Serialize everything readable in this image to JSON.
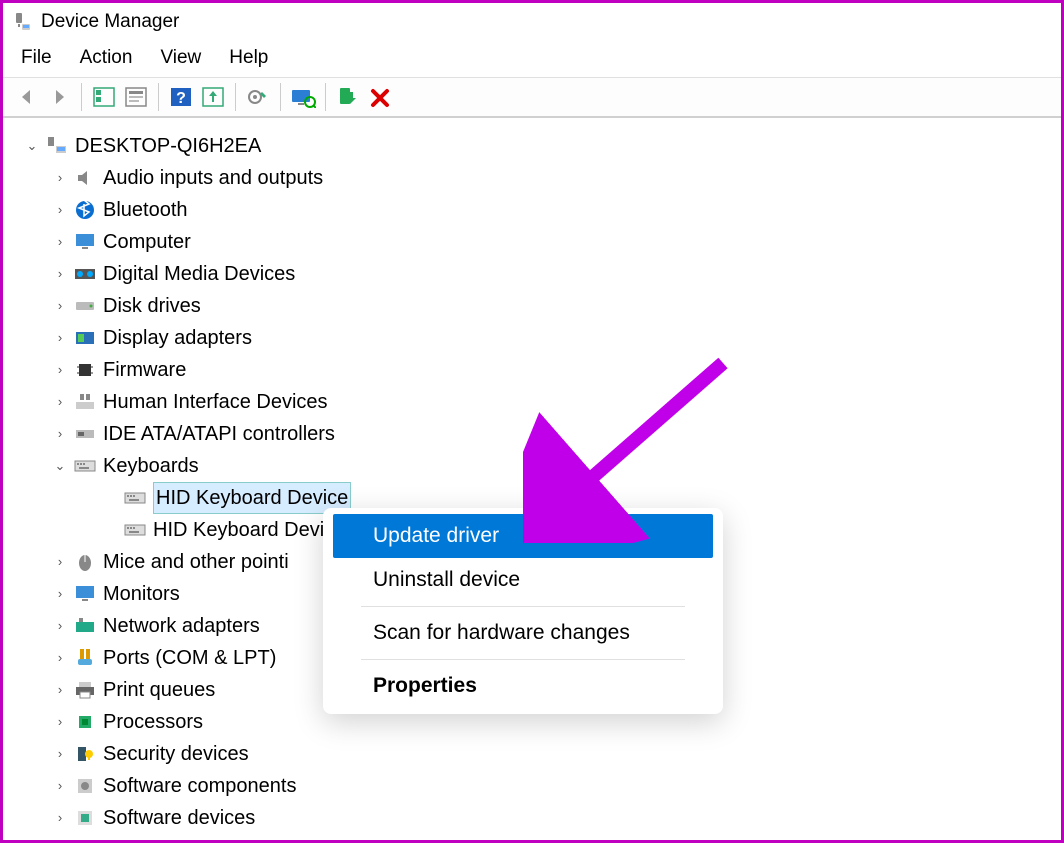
{
  "window": {
    "title": "Device Manager"
  },
  "menu": {
    "items": [
      "File",
      "Action",
      "View",
      "Help"
    ]
  },
  "tree": {
    "root": {
      "label": "DESKTOP-QI6H2EA",
      "expanded": true
    },
    "children": [
      {
        "label": "Audio inputs and outputs",
        "expanded": false
      },
      {
        "label": "Bluetooth",
        "expanded": false
      },
      {
        "label": "Computer",
        "expanded": false
      },
      {
        "label": "Digital Media Devices",
        "expanded": false
      },
      {
        "label": "Disk drives",
        "expanded": false
      },
      {
        "label": "Display adapters",
        "expanded": false
      },
      {
        "label": "Firmware",
        "expanded": false
      },
      {
        "label": "Human Interface Devices",
        "expanded": false
      },
      {
        "label": "IDE ATA/ATAPI controllers",
        "expanded": false
      },
      {
        "label": "Keyboards",
        "expanded": true,
        "children": [
          {
            "label": "HID Keyboard Device",
            "selected": true
          },
          {
            "label": "HID Keyboard Device"
          }
        ]
      },
      {
        "label": "Mice and other pointing devices",
        "expanded": false,
        "truncated": "Mice and other pointi"
      },
      {
        "label": "Monitors",
        "expanded": false
      },
      {
        "label": "Network adapters",
        "expanded": false
      },
      {
        "label": "Ports (COM & LPT)",
        "expanded": false
      },
      {
        "label": "Print queues",
        "expanded": false
      },
      {
        "label": "Processors",
        "expanded": false
      },
      {
        "label": "Security devices",
        "expanded": false
      },
      {
        "label": "Software components",
        "expanded": false
      },
      {
        "label": "Software devices",
        "expanded": false
      }
    ]
  },
  "context_menu": {
    "items": [
      {
        "label": "Update driver",
        "highlighted": true
      },
      {
        "label": "Uninstall device"
      },
      {
        "sep": true
      },
      {
        "label": "Scan for hardware changes"
      },
      {
        "sep": true
      },
      {
        "label": "Properties",
        "bold": true
      }
    ]
  },
  "toolbar": {
    "buttons": [
      "back",
      "forward",
      "properties-all",
      "properties",
      "help",
      "update",
      "settings",
      "scan",
      "uninstall",
      "delete"
    ]
  }
}
